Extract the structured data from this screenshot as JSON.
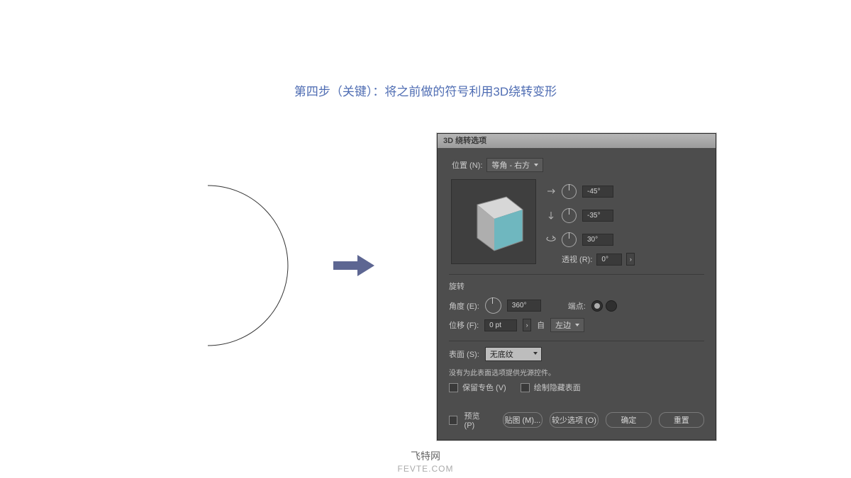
{
  "title": "第四步（关键）：将之前做的符号利用3D绕转变形",
  "dialog": {
    "title": "3D 绕转选项",
    "position_label": "位置 (N):",
    "position_value": "等角 - 右方",
    "angles": {
      "x": "-45°",
      "y": "-35°",
      "z": "30°"
    },
    "perspective_label": "透视 (R):",
    "perspective_value": "0°",
    "revolve_header": "旋转",
    "angle_label": "角度 (E):",
    "angle_value": "360°",
    "cap_label": "端点:",
    "offset_label": "位移 (F):",
    "offset_value": "0 pt",
    "from_label": "自",
    "from_value": "左边",
    "surface_label": "表面 (S):",
    "surface_value": "无底纹",
    "note": "没有为此表面选项提供光源控件。",
    "preserve_spot": "保留专色 (V)",
    "draw_hidden": "绘制隐藏表面",
    "preview": "预览 (P)",
    "map_art": "贴图 (M)...",
    "fewer_options": "较少选项 (O)",
    "ok": "确定",
    "reset": "重置"
  },
  "watermark1": "飞特网",
  "watermark2": "FEVTE.COM"
}
